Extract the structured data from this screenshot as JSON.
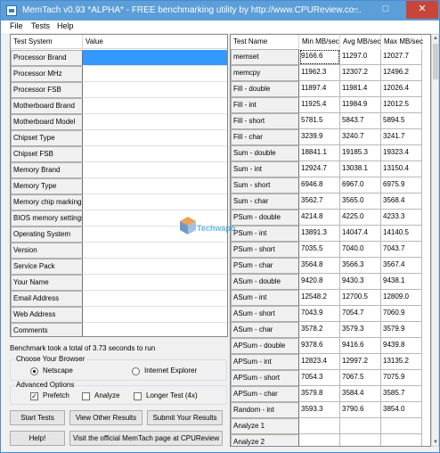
{
  "window": {
    "title": "MemTach v0.93 *ALPHA* - FREE benchmarking utility by http://www.CPUReview.co...",
    "controls": {
      "minimize": "–",
      "maximize": "□",
      "close": "✕"
    }
  },
  "menu": [
    "File",
    "Tests",
    "Help"
  ],
  "system_table": {
    "headers": [
      "Test System",
      "Value"
    ],
    "rows": [
      {
        "label": "Processor Brand"
      },
      {
        "label": "Processor MHz"
      },
      {
        "label": "Processor FSB"
      },
      {
        "label": "Motherboard Brand"
      },
      {
        "label": "Motherboard Model"
      },
      {
        "label": "Chipset Type"
      },
      {
        "label": "Chipset FSB"
      },
      {
        "label": "Memory Brand"
      },
      {
        "label": "Memory Type"
      },
      {
        "label": "Memory chip markings"
      },
      {
        "label": "BIOS memory settings"
      },
      {
        "label": "Operating System"
      },
      {
        "label": "Version"
      },
      {
        "label": "Service Pack"
      },
      {
        "label": "Your Name"
      },
      {
        "label": "Email Address"
      },
      {
        "label": "Web Address"
      },
      {
        "label": "Comments"
      }
    ]
  },
  "status_text": "Benchmark took a total of 3.73 seconds to run",
  "browser_group": {
    "title": "Choose Your Browser",
    "options": [
      "Netscape",
      "Internet Explorer"
    ],
    "selected": "Netscape"
  },
  "advanced_group": {
    "title": "Advanced Options",
    "options": [
      {
        "label": "Prefetch",
        "checked": true
      },
      {
        "label": "Analyze",
        "checked": false
      },
      {
        "label": "Longer Test (4x)",
        "checked": false
      }
    ]
  },
  "buttons": {
    "start": "Start Tests",
    "view_other": "View Other Results",
    "submit": "Submit Your Results",
    "help": "Help!",
    "visit": "Visit the official MemTach page at CPUReview"
  },
  "results_table": {
    "headers": [
      "Test Name",
      "Min MB/sec",
      "Avg MB/sec",
      "Max MB/sec"
    ],
    "rows": [
      {
        "name": "memset",
        "min": "9166.6",
        "avg": "11297.0",
        "max": "12027.7"
      },
      {
        "name": "memcpy",
        "min": "11962.3",
        "avg": "12307.2",
        "max": "12496.2"
      },
      {
        "name": "Fill - double",
        "min": "11897.4",
        "avg": "11981.4",
        "max": "12026.4"
      },
      {
        "name": "Fill - int",
        "min": "11925.4",
        "avg": "11984.9",
        "max": "12012.5"
      },
      {
        "name": "Fill - short",
        "min": "5781.5",
        "avg": "5843.7",
        "max": "5894.5"
      },
      {
        "name": "Fill - char",
        "min": "3239.9",
        "avg": "3240.7",
        "max": "3241.7"
      },
      {
        "name": "Sum - double",
        "min": "18841.1",
        "avg": "19185.3",
        "max": "19323.4"
      },
      {
        "name": "Sum - int",
        "min": "12924.7",
        "avg": "13038.1",
        "max": "13150.4"
      },
      {
        "name": "Sum - short",
        "min": "6946.8",
        "avg": "6967.0",
        "max": "6975.9"
      },
      {
        "name": "Sum - char",
        "min": "3562.7",
        "avg": "3565.0",
        "max": "3568.4"
      },
      {
        "name": "PSum - double",
        "min": "4214.8",
        "avg": "4225.0",
        "max": "4233.3"
      },
      {
        "name": "PSum - int",
        "min": "13891.3",
        "avg": "14047.4",
        "max": "14140.5"
      },
      {
        "name": "PSum - short",
        "min": "7035.5",
        "avg": "7040.0",
        "max": "7043.7"
      },
      {
        "name": "PSum - char",
        "min": "3564.8",
        "avg": "3566.3",
        "max": "3567.4"
      },
      {
        "name": "ASum - double",
        "min": "9420.8",
        "avg": "9430.3",
        "max": "9438.1"
      },
      {
        "name": "ASum - int",
        "min": "12548.2",
        "avg": "12700.5",
        "max": "12809.0"
      },
      {
        "name": "ASum - short",
        "min": "7043.9",
        "avg": "7054.7",
        "max": "7060.9"
      },
      {
        "name": "ASum - char",
        "min": "3578.2",
        "avg": "3579.3",
        "max": "3579.9"
      },
      {
        "name": "APSum - double",
        "min": "9378.6",
        "avg": "9416.6",
        "max": "9439.8"
      },
      {
        "name": "APSum - int",
        "min": "12823.4",
        "avg": "12997.2",
        "max": "13135.2"
      },
      {
        "name": "APSum - short",
        "min": "7054.3",
        "avg": "7067.5",
        "max": "7075.9"
      },
      {
        "name": "APSum - char",
        "min": "3579.8",
        "avg": "3584.4",
        "max": "3585.7"
      },
      {
        "name": "Random - int",
        "min": "3593.3",
        "avg": "3790.6",
        "max": "3854.0"
      },
      {
        "name": "Analyze 1",
        "min": "",
        "avg": "",
        "max": ""
      },
      {
        "name": "Analyze 2",
        "min": "",
        "avg": "",
        "max": ""
      }
    ]
  },
  "watermark": {
    "text": "Techwapo"
  },
  "colors": {
    "selection": "#3399ff",
    "titlebar": "#5b9ed8",
    "close": "#c8453a"
  }
}
